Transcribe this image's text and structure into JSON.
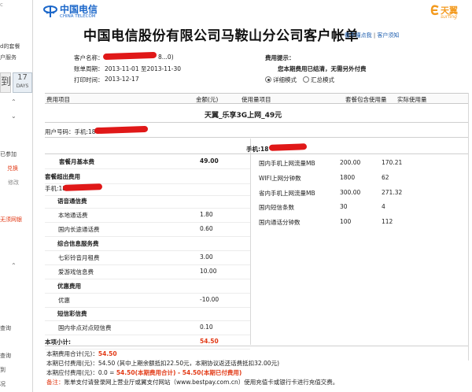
{
  "sidebar": {
    "line1": "c",
    "line2": "d的套餐",
    "line3": "户服务",
    "calendar_left": "到",
    "calendar_num": "17",
    "calendar_unit": "DAYS",
    "item_joined": "已参加",
    "item_redeem": "兑换",
    "item_fix": "修改",
    "item_promo": "无须网银",
    "item_query1": "查询",
    "item_query2": "查询",
    "item_mid": "到",
    "item_last": "况"
  },
  "header": {
    "brand_cn": "中国电信",
    "brand_en": "CHINA TELECOM",
    "tianyi_cn": "天翼",
    "tianyi_en": "surfing",
    "title": "中国电信股份有限公司马鞍山分公司客户帐单",
    "link_help1": "看不懂点我",
    "link_help2": "客户须知",
    "link_sep": "|"
  },
  "account": {
    "name_label": "客户名称：",
    "name_tail": "8...0)",
    "period_label": "账单周期：",
    "period_value": "2013-11-01 至2013-11-30",
    "print_label": "打印时间：",
    "print_value": "2013-12-17",
    "tip_label": "费用提示：",
    "tip_text": "您本期费用已结清，无需另外付费",
    "mode_detail": "详细模式",
    "mode_summary": "汇总模式"
  },
  "columns": {
    "fee_item": "费用项目",
    "amount": "金额(元)",
    "usage_item": "使用量项目",
    "package_usage": "套餐包含使用量",
    "actual_usage": "实际使用量"
  },
  "package_name": "天翼_乐享3G上网_49元",
  "user_line": "用户号码：手机:18",
  "right_phone": "手机:18",
  "fees": [
    {
      "label": "套餐月基本费",
      "amount": "49.00",
      "bold": true
    },
    {
      "label": "套餐超出费用",
      "amount": "",
      "bold": true
    },
    {
      "label": "手机:18",
      "amount": "",
      "bold": false
    },
    {
      "label": "语音通信费",
      "amount": "",
      "bold": true
    },
    {
      "label": "本地通话费",
      "amount": "1.80",
      "bold": false
    },
    {
      "label": "国内长途通话费",
      "amount": "0.60",
      "bold": false
    },
    {
      "label": "综合信息服务费",
      "amount": "",
      "bold": true
    },
    {
      "label": "七彩铃音月租费",
      "amount": "3.00",
      "bold": false
    },
    {
      "label": "爱游戏信息费",
      "amount": "10.00",
      "bold": false
    },
    {
      "label": "优惠费用",
      "amount": "",
      "bold": true
    },
    {
      "label": "优惠",
      "amount": "-10.00",
      "bold": false
    },
    {
      "label": "短信彩信费",
      "amount": "",
      "bold": true
    },
    {
      "label": "国内非点对点短信费",
      "amount": "0.10",
      "bold": false
    },
    {
      "label": "本项小计:",
      "amount": "54.50",
      "bold": true
    }
  ],
  "usage": [
    {
      "item": "国内手机上网流量MB",
      "included": "200.00",
      "actual": "170.21"
    },
    {
      "item": "WIFI上网分钟数",
      "included": "1800",
      "actual": "62"
    },
    {
      "item": "省内手机上网流量MB",
      "included": "300.00",
      "actual": "271.32"
    },
    {
      "item": "国内短信条数",
      "included": "30",
      "actual": "4"
    },
    {
      "item": "国内通话分钟数",
      "included": "100",
      "actual": "112"
    }
  ],
  "summary": {
    "line1_label": "本期费用合计(元)：",
    "line1_value": "54.50",
    "line2": "本期已付费用(元)：54.50 (其中上期余额抵扣22.50元，本期协议返还话费抵扣32.00元)",
    "line3_a": "本期应付费用(元)：0.0 = ",
    "line3_b": "54.50(本期费用合计) - 54.50(本期已付费用)",
    "note_label": "备注：",
    "note_text": "账单支付请登录网上营业厅或翼支付网站（www.bestpay.com.cn）使用充值卡或银行卡进行充值交费。"
  },
  "colors": {
    "brand_blue": "#1a66c9",
    "accent_red": "#e23a16",
    "link_blue": "#1c5dae",
    "tianyi_orange": "#f39a1e"
  }
}
